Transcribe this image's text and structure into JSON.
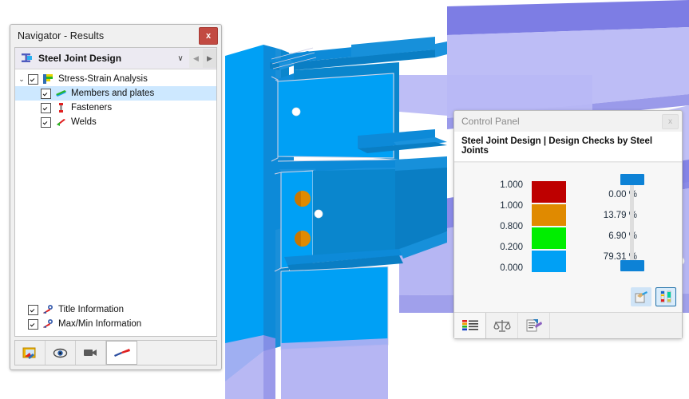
{
  "navigator": {
    "title": "Navigator - Results",
    "close_label": "x",
    "combo": {
      "label": "Steel Joint Design",
      "icon": "steel-joint-icon",
      "dropdown_arrow": "∨",
      "prev_arrow": "◀",
      "next_arrow": "▶"
    },
    "tree": [
      {
        "label": "Stress-Strain Analysis",
        "icon": "stress-strain-icon",
        "checked": true,
        "expanded": true,
        "selected": false,
        "level": 0
      },
      {
        "label": "Members and plates",
        "icon": "members-plates-icon",
        "checked": true,
        "selected": true,
        "level": 1
      },
      {
        "label": "Fasteners",
        "icon": "fasteners-icon",
        "checked": true,
        "selected": false,
        "level": 1
      },
      {
        "label": "Welds",
        "icon": "welds-icon",
        "checked": true,
        "selected": false,
        "level": 1
      }
    ],
    "tree_lower": [
      {
        "label": "Title Information",
        "icon": "title-information-icon",
        "checked": true
      },
      {
        "label": "Max/Min Information",
        "icon": "maxmin-information-icon",
        "checked": true
      }
    ],
    "toolbar": [
      {
        "name": "results-display-button",
        "icon": "results-image-icon",
        "active": false
      },
      {
        "name": "view-visibility-button",
        "icon": "eye-icon",
        "active": false
      },
      {
        "name": "animation-button",
        "icon": "video-camera-icon",
        "active": false
      },
      {
        "name": "deformation-button",
        "icon": "deformation-arrow-icon",
        "active": true
      }
    ]
  },
  "control_panel": {
    "title": "Control Panel",
    "close_label": "x",
    "heading": "Steel Joint Design | Design Checks by Steel Joints",
    "legend": {
      "values": [
        "1.000",
        "1.000",
        "0.800",
        "0.200",
        "0.000"
      ],
      "bands": [
        {
          "color": "#be0000",
          "percent": "0.00 %"
        },
        {
          "color": "#e08a00",
          "percent": "13.79 %"
        },
        {
          "color": "#00ee00",
          "percent": "6.90 %"
        },
        {
          "color": "#00a0f5",
          "percent": "79.31 %"
        }
      ],
      "slider_color": "#0d82d6"
    },
    "right_buttons": [
      {
        "name": "color-spectrum-edit-button",
        "icon": "paint-palette-icon",
        "selected": false
      },
      {
        "name": "color-scale-button",
        "icon": "color-scale-icon",
        "selected": true
      }
    ],
    "tabs": [
      {
        "name": "tab-color-scale",
        "icon": "color-legend-icon",
        "active": true
      },
      {
        "name": "tab-factors",
        "icon": "balance-scale-icon",
        "active": false
      },
      {
        "name": "tab-display-properties",
        "icon": "display-properties-icon",
        "active": false
      }
    ]
  },
  "viewport": {
    "colors": {
      "steel_bright": "#00a0f5",
      "steel_mid": "#0d8ad8",
      "steel_dark": "#0a7ec4",
      "transparent_beam": "#a7a7f0",
      "transparent_beam_dark": "#6b6be0",
      "transparent_light": "#b9b9f5",
      "bolt": "#e08a00",
      "bolt_dark": "#c97600",
      "node": "#ffffff",
      "edge": "#d8d8e8"
    }
  }
}
